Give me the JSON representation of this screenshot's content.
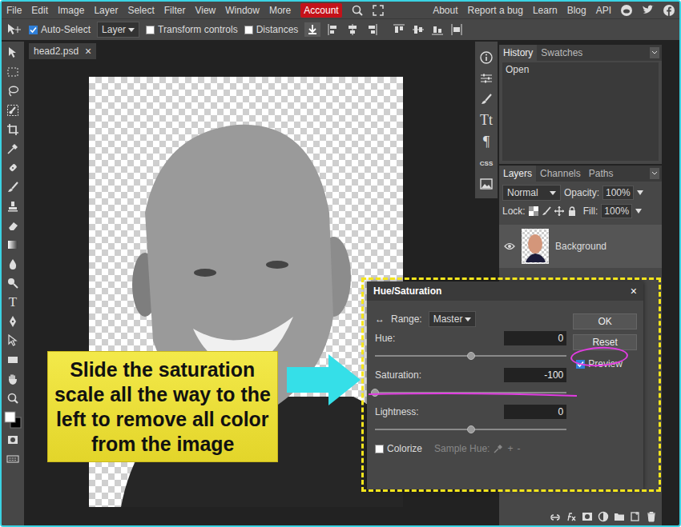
{
  "menubar": {
    "items": [
      "File",
      "Edit",
      "Image",
      "Layer",
      "Select",
      "Filter",
      "View",
      "Window",
      "More"
    ],
    "account": "Account",
    "links": [
      "About",
      "Report a bug",
      "Learn",
      "Blog",
      "API"
    ]
  },
  "toolbar": {
    "auto_select": {
      "label": "Auto-Select",
      "checked": true
    },
    "select": "Layer",
    "transform_controls": {
      "label": "Transform controls",
      "checked": false
    },
    "distances": {
      "label": "Distances",
      "checked": false
    }
  },
  "tools": {
    "type_tool": "T"
  },
  "document": {
    "tab": "head2.psd",
    "close": "×"
  },
  "side_icons": {
    "text": "Tt",
    "paragraph": "¶",
    "css": "CSS"
  },
  "history": {
    "tabs": [
      {
        "label": "History",
        "selected": true
      },
      {
        "label": "Swatches",
        "selected": false
      }
    ],
    "items": [
      {
        "label": "Open",
        "selected": false
      }
    ]
  },
  "layers": {
    "tabs": [
      {
        "label": "Layers",
        "selected": true
      },
      {
        "label": "Channels",
        "selected": false
      },
      {
        "label": "Paths",
        "selected": false
      }
    ],
    "blend_mode": "Normal",
    "opacity_label": "Opacity:",
    "opacity": "100%",
    "lock_label": "Lock:",
    "fill_label": "Fill:",
    "fill": "100%",
    "items": [
      {
        "name": "Background",
        "visible": true,
        "selected": true
      }
    ]
  },
  "dialog": {
    "title": "Hue/Saturation",
    "close": "×",
    "range_icon": "↔",
    "range_label": "Range:",
    "range": "Master",
    "sliders": [
      {
        "label": "Hue:",
        "value": "0",
        "level": 0.5
      },
      {
        "label": "Saturation:",
        "value": "-100",
        "level": 0
      },
      {
        "label": "Lightness:",
        "value": "0",
        "level": 0.5
      }
    ],
    "colorize": {
      "label": "Colorize",
      "checked": false
    },
    "sample_hue": "Sample Hue:",
    "sample_plus": "+",
    "sample_minus": "-",
    "buttons": [
      "OK",
      "Reset"
    ],
    "preview": {
      "label": "Preview",
      "checked": true
    }
  },
  "callout": {
    "lines": [
      "Slide the saturation",
      "scale all the way to the",
      "left to remove all color",
      "from the image"
    ]
  }
}
